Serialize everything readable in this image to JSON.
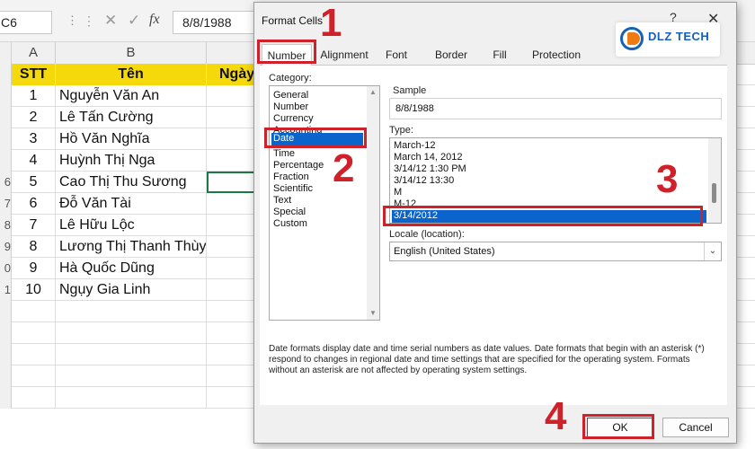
{
  "formula_bar": {
    "name_box": "C6",
    "cancel_glyph": "✕",
    "enter_glyph": "✓",
    "fx_glyph": "fx",
    "value": "8/8/1988"
  },
  "sheet": {
    "columns": [
      "A",
      "B"
    ],
    "header": {
      "stt": "STT",
      "ten": "Tên",
      "ngay": "Ngày"
    },
    "row_numbers": [
      "6",
      "7",
      "8",
      "9",
      "0",
      "1"
    ],
    "rows": [
      {
        "stt": "1",
        "ten": "Nguyễn Văn An"
      },
      {
        "stt": "2",
        "ten": "Lê Tấn Cường"
      },
      {
        "stt": "3",
        "ten": "Hồ Văn Nghĩa"
      },
      {
        "stt": "4",
        "ten": "Huỳnh Thị Nga"
      },
      {
        "stt": "5",
        "ten": "Cao Thị Thu Sương"
      },
      {
        "stt": "6",
        "ten": "Đỗ Văn Tài"
      },
      {
        "stt": "7",
        "ten": "Lê Hữu Lộc"
      },
      {
        "stt": "8",
        "ten": "Lương Thị Thanh Thùy"
      },
      {
        "stt": "9",
        "ten": "Hà Quốc Dũng"
      },
      {
        "stt": "10",
        "ten": "Ngụy Gia Linh"
      }
    ],
    "header_color": "#f5d90b"
  },
  "dialog": {
    "title": "Format Cells",
    "help": "?",
    "close": "✕",
    "tabs": [
      "Number",
      "Alignment",
      "Font",
      "Border",
      "Fill",
      "Protection"
    ],
    "active_tab": "Number",
    "category_label": "Category:",
    "categories": [
      "General",
      "Number",
      "Currency",
      "Accounting",
      "Date",
      "Time",
      "Percentage",
      "Fraction",
      "Scientific",
      "Text",
      "Special",
      "Custom"
    ],
    "selected_category": "Date",
    "sample_label": "Sample",
    "sample_value": "8/8/1988",
    "type_label": "Type:",
    "types": [
      "March-12",
      "March 14, 2012",
      "3/14/12 1:30 PM",
      "3/14/12 13:30",
      "M",
      "M-12",
      "3/14/2012"
    ],
    "selected_type": "3/14/2012",
    "locale_label": "Locale (location):",
    "locale_value": "English (United States)",
    "description": "Date formats display date and time serial numbers as date values.  Date formats that begin with an asterisk (*) respond to changes in regional date and time settings that are specified for the operating system. Formats without an asterisk are not affected by operating system settings.",
    "ok_label": "OK",
    "cancel_label": "Cancel"
  },
  "annotations": {
    "step1": "1",
    "step2": "2",
    "step3": "3",
    "step4": "4",
    "highlight_color": "#d0202a"
  },
  "logo": {
    "text": "DLZ TECH",
    "tagline": ""
  }
}
